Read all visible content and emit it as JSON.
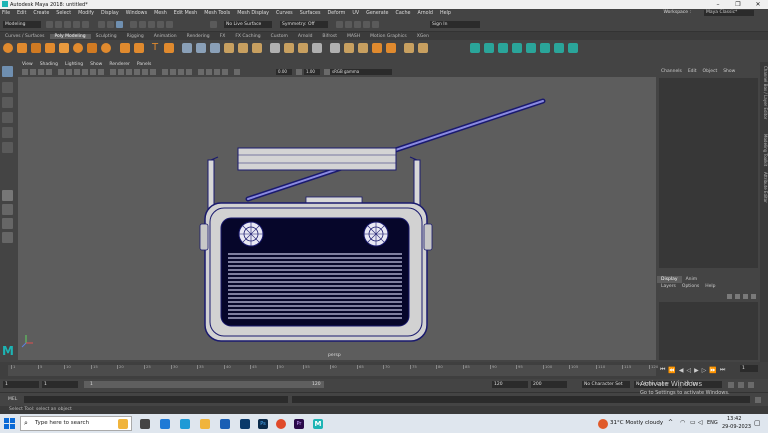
{
  "window": {
    "title": "Autodesk Maya 2018: untitled*",
    "minimize": "–",
    "maximize": "❐",
    "close": "✕"
  },
  "menubar": [
    "File",
    "Edit",
    "Create",
    "Select",
    "Modify",
    "Display",
    "Windows",
    "Mesh",
    "Edit Mesh",
    "Mesh Tools",
    "Mesh Display",
    "Curves",
    "Surfaces",
    "Deform",
    "UV",
    "Generate",
    "Cache",
    "Arnold",
    "Help"
  ],
  "workspace": {
    "label": "Workspace :",
    "value": "Maya Classic*"
  },
  "statusline": {
    "mode": "Modeling",
    "live_surface": "No Live Surface",
    "symmetry": "Symmetry: Off",
    "sign_in": "Sign In"
  },
  "shelf_tabs": [
    "Curves / Surfaces",
    "Poly Modeling",
    "Sculpting",
    "Rigging",
    "Animation",
    "Rendering",
    "FX",
    "FX Caching",
    "Custom",
    "Arnold",
    "Bifrost",
    "MASH",
    "Motion Graphics",
    "XGen"
  ],
  "active_shelf_tab": "Poly Modeling",
  "panel_menu": [
    "View",
    "Shading",
    "Lighting",
    "Show",
    "Renderer",
    "Panels"
  ],
  "panel_fields": {
    "exposure": "0.00",
    "gamma": "1.00",
    "color_space": "sRGB gamma"
  },
  "viewport": {
    "camera_label": "persp"
  },
  "channel_box": {
    "menu": [
      "Channels",
      "Edit",
      "Object",
      "Show"
    ]
  },
  "layer_editor": {
    "tabs": [
      "Display",
      "Anim"
    ],
    "active_tab": "Display",
    "menu": [
      "Layers",
      "Options",
      "Help"
    ]
  },
  "side_tabs": [
    "Channel Box / Layer Editor",
    "Modeling Toolkit",
    "Attribute Editor"
  ],
  "time_slider": {
    "ticks": [
      "1",
      "5",
      "10",
      "15",
      "20",
      "25",
      "30",
      "35",
      "40",
      "45",
      "50",
      "55",
      "60",
      "65",
      "70",
      "75",
      "80",
      "85",
      "90",
      "95",
      "100",
      "105",
      "110",
      "115",
      "120"
    ],
    "current_frame": "1"
  },
  "range": {
    "start": "1",
    "playback_start": "1",
    "playback_end": "120",
    "end": "120",
    "anim_end": "200",
    "character_set": "No Character Set",
    "anim_layer": "No Anim Layer",
    "fps": "24 fps"
  },
  "mel": {
    "label": "MEL"
  },
  "help_line": "Select Tool: select an object",
  "windows_watermark": {
    "line1": "Activate Windows",
    "line2": "Go to Settings to activate Windows."
  },
  "taskbar": {
    "search_placeholder": "Type here to search",
    "weather": "31°C  Mostly cloudy",
    "language": "ENG",
    "time": "13:42",
    "date": "29-09-2023"
  },
  "colors": {
    "viewport": "#5d5d5d",
    "wire": "#1a1a6e",
    "shelf_orange": "#e08a2e",
    "shelf_teal": "#2aa59a",
    "maya_logo": "#1db4b4"
  }
}
